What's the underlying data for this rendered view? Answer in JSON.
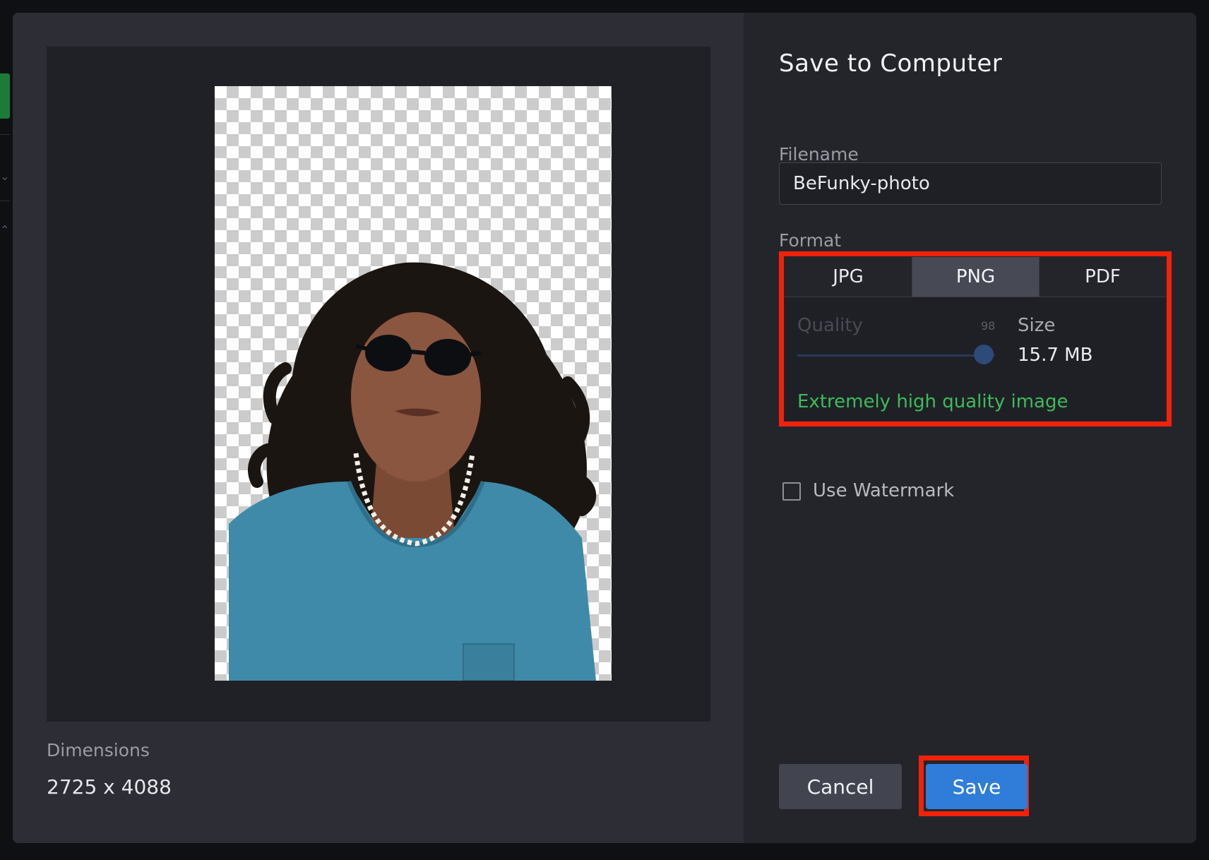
{
  "dialog": {
    "title": "Save to Computer"
  },
  "preview": {
    "dimensions_label": "Dimensions",
    "dimensions_value": "2725 x 4088"
  },
  "filename": {
    "label": "Filename",
    "value": "BeFunky-photo"
  },
  "format": {
    "label": "Format",
    "tabs": [
      {
        "label": "JPG",
        "active": false
      },
      {
        "label": "PNG",
        "active": true
      },
      {
        "label": "PDF",
        "active": false
      }
    ],
    "quality_label": "Quality",
    "quality_value": "98",
    "size_label": "Size",
    "size_value": "15.7 MB",
    "quality_message": "Extremely high quality image"
  },
  "watermark": {
    "label": "Use Watermark",
    "checked": false
  },
  "buttons": {
    "cancel": "Cancel",
    "save": "Save"
  },
  "colors": {
    "accent_blue": "#2f7dd9",
    "highlight_red": "#f0220a",
    "success_green": "#3dbb5a"
  }
}
